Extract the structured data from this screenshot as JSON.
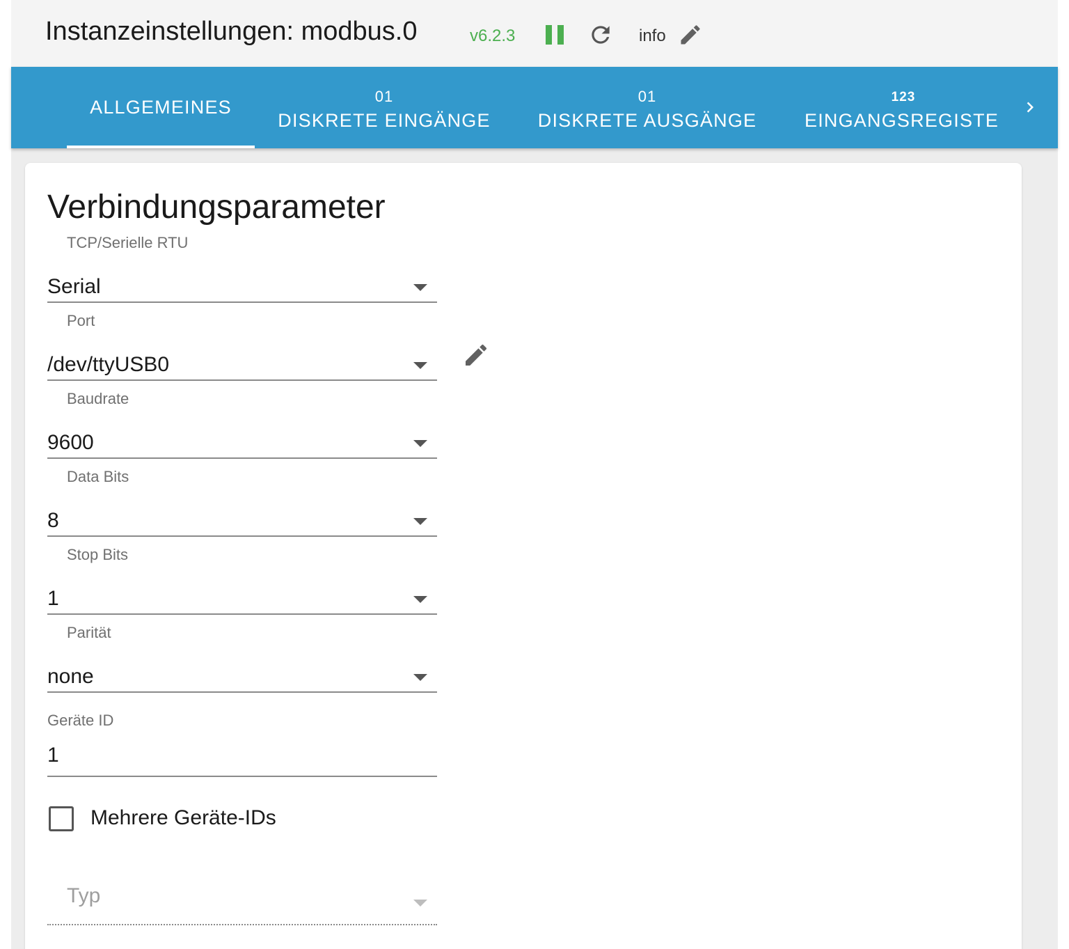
{
  "header": {
    "title": "Instanzeinstellungen: modbus.0",
    "version": "v6.2.3",
    "info_label": "info",
    "pause_icon": "pause-icon",
    "reload_icon": "reload-icon",
    "edit_icon": "pencil-icon",
    "accent_color": "#4caf50"
  },
  "tabs": {
    "bar_color": "#3399cc",
    "items": [
      {
        "label": "ALLGEMEINES",
        "icon": "",
        "active": true
      },
      {
        "label": "DISKRETE EINGÄNGE",
        "icon": "01",
        "active": false
      },
      {
        "label": "DISKRETE AUSGÄNGE",
        "icon": "01",
        "active": false
      },
      {
        "label": "EINGANGSREGISTE",
        "icon": "123",
        "active": false
      }
    ],
    "scroll_icon": "chevron-right-icon"
  },
  "section": {
    "title": "Verbindungsparameter",
    "fields": [
      {
        "label": "TCP/Serielle RTU",
        "value": "Serial"
      },
      {
        "label": "Port",
        "value": "/dev/ttyUSB0"
      },
      {
        "label": "Baudrate",
        "value": "9600"
      },
      {
        "label": "Data Bits",
        "value": "8"
      },
      {
        "label": "Stop Bits",
        "value": "1"
      },
      {
        "label": "Parität",
        "value": "none"
      }
    ],
    "device_id": {
      "label": "Geräte ID",
      "value": "1"
    },
    "multi_device": {
      "label": "Mehrere Geräte-IDs",
      "checked": false
    },
    "type_select": {
      "placeholder": "Typ",
      "value": ""
    }
  }
}
